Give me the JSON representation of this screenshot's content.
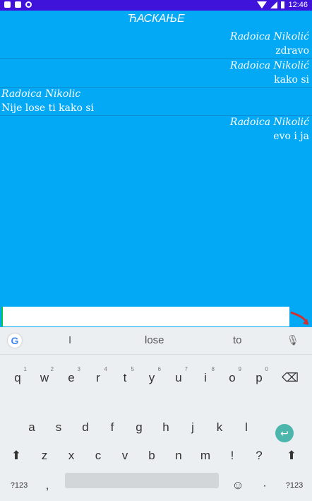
{
  "status": {
    "time": "12:46"
  },
  "header": {
    "title": "ЋАСКАЊЕ"
  },
  "messages": [
    {
      "side": "right",
      "author": "Radoica Nikolić",
      "text": "zdravo"
    },
    {
      "side": "right",
      "author": "Radoica Nikolić",
      "text": "kako si"
    },
    {
      "side": "left",
      "author": "Radoica Nikolic",
      "text": "Nije lose ti kako si"
    },
    {
      "side": "right",
      "author": "Radoica Nikolić",
      "text": "evo i ja"
    }
  ],
  "input": {
    "value": ""
  },
  "keyboard": {
    "suggestions": [
      "I",
      "lose",
      "to"
    ],
    "google": "G",
    "row1": [
      "q",
      "w",
      "e",
      "r",
      "t",
      "y",
      "u",
      "i",
      "o",
      "p"
    ],
    "row1_hints": [
      "1",
      "2",
      "3",
      "4",
      "5",
      "6",
      "7",
      "8",
      "9",
      "0"
    ],
    "row2": [
      "a",
      "s",
      "d",
      "f",
      "g",
      "h",
      "j",
      "k",
      "l"
    ],
    "row3": [
      "z",
      "x",
      "c",
      "v",
      "b",
      "n",
      "m",
      "!",
      "?"
    ],
    "bottom_left": "?123",
    "comma": ",",
    "emoji": "☺",
    "period": "·",
    "bottom_right": "?123"
  },
  "colors": {
    "background": "#03A9F4",
    "statusbar": "#3F13D9",
    "send": "#D32F2F"
  }
}
